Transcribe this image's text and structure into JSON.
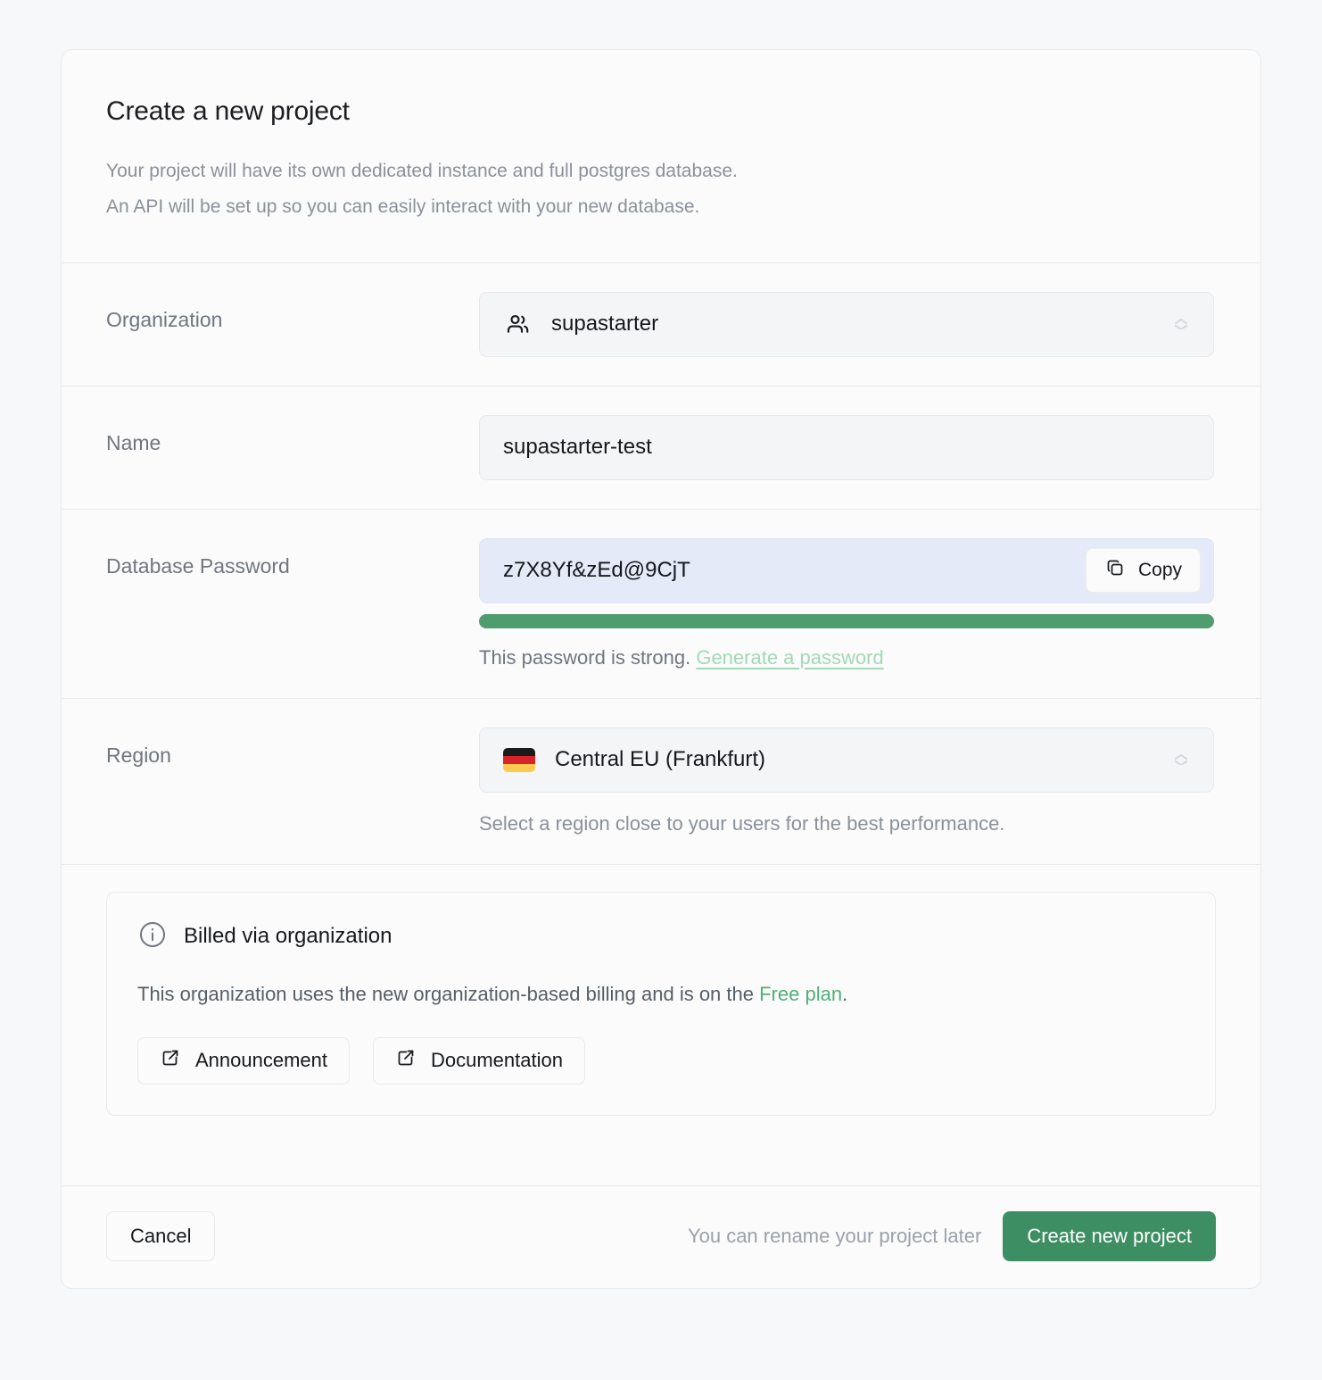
{
  "dialog": {
    "title": "Create a new project",
    "description_line1": "Your project will have its own dedicated instance and full postgres database.",
    "description_line2": "An API will be set up so you can easily interact with your new database."
  },
  "fields": {
    "organization": {
      "label": "Organization",
      "value": "supastarter",
      "icon": "users-icon"
    },
    "name": {
      "label": "Name",
      "value": "supastarter-test"
    },
    "password": {
      "label": "Database Password",
      "value": "z7X8Yf&zEd@9CjT",
      "copy_label": "Copy",
      "copy_icon": "copy-icon",
      "strength_text": "This password is strong.",
      "generate_link": "Generate a password",
      "strength_color": "#4f9d6e",
      "strength_percent": 100
    },
    "region": {
      "label": "Region",
      "value": "Central EU (Frankfurt)",
      "flag": "germany-flag",
      "helper": "Select a region close to your users for the best performance."
    }
  },
  "billing": {
    "icon": "info-icon",
    "title": "Billed via organization",
    "body_before": "This organization uses the new organization-based billing and is on the ",
    "plan_link": "Free plan",
    "body_after": ".",
    "buttons": [
      {
        "label": "Announcement",
        "icon": "external-link-icon"
      },
      {
        "label": "Documentation",
        "icon": "external-link-icon"
      }
    ]
  },
  "footer": {
    "cancel_label": "Cancel",
    "note": "You can rename your project later",
    "submit_label": "Create new project",
    "submit_color": "#3e8e63"
  }
}
